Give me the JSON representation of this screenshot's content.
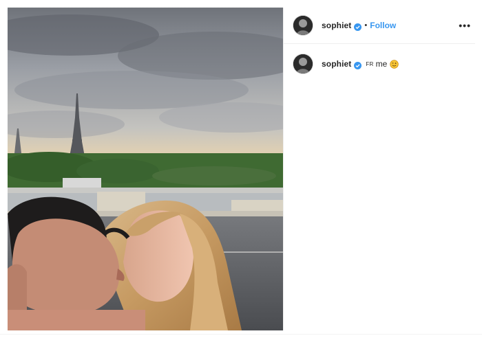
{
  "post": {
    "username": "sophiet",
    "dot": "•",
    "follow_label": "Follow",
    "more_label": "•••"
  },
  "caption": {
    "username": "sophiet",
    "flag_text": "FR",
    "text": "me",
    "emoji": "winking-face-icon"
  },
  "colors": {
    "follow": "#3897f0",
    "verified": "#3897f0",
    "border": "#efefef"
  }
}
